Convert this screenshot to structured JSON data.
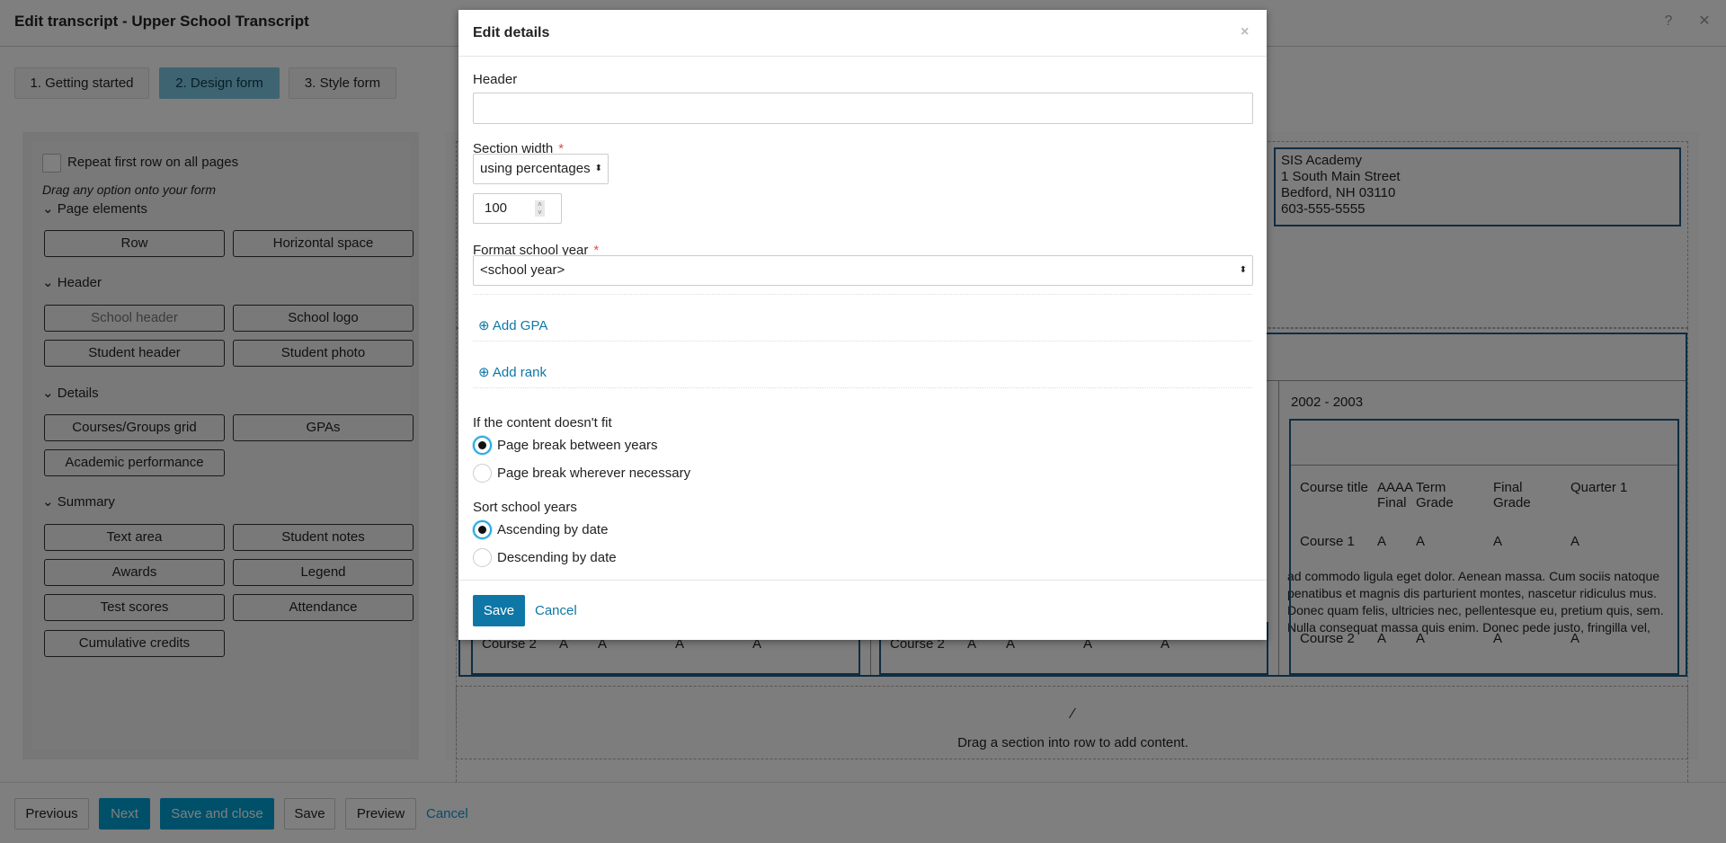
{
  "window": {
    "title": "Edit transcript - Upper School Transcript",
    "help_icon": "question-circle-icon",
    "close_icon": "close-icon"
  },
  "tabs": [
    {
      "label": "1. Getting started",
      "active": false
    },
    {
      "label": "2. Design form",
      "active": true
    },
    {
      "label": "3. Style form",
      "active": false
    }
  ],
  "palette": {
    "repeat_first_row": "Repeat first row on all pages",
    "hint": "Drag any option onto your form",
    "sections": [
      {
        "title": "Page elements",
        "items": [
          "Row",
          "Horizontal space"
        ]
      },
      {
        "title": "Header",
        "items": [
          "School header",
          "School logo",
          "Student header",
          "Student photo"
        ]
      },
      {
        "title": "Details",
        "items": [
          "Courses/Groups grid",
          "GPAs",
          "Academic performance"
        ]
      },
      {
        "title": "Summary",
        "items": [
          "Text area",
          "Student notes",
          "Awards",
          "Legend",
          "Test scores",
          "Attendance",
          "Cumulative credits"
        ]
      }
    ]
  },
  "canvas": {
    "school_address": [
      "SIS Academy",
      "1 South  Main Street",
      "Bedford, NH 03110",
      " 603-555-5555"
    ],
    "year": "2002 - 2003",
    "grid_headers": [
      "Course title",
      "AAAA Final",
      "Term Grade",
      "Final Grade",
      "Quarter 1"
    ],
    "rows": [
      [
        "Course 1",
        "A",
        "A",
        "A",
        "A"
      ],
      [
        "Course 2",
        "A",
        "A",
        "A",
        "A"
      ]
    ],
    "lorem": "ad commodo ligula eget dolor. Aenean massa. Cum sociis natoque penatibus et magnis dis parturient montes, nascetur ridiculus mus. Donec quam felis, ultricies nec, pellentesque eu, pretium quis, sem. Nulla consequat massa quis enim. Donec pede justo, fringilla vel, aliquet nec, vulputate eget, arcu. In enim justo, rhoncus ut, imperdiet a, venenatis vitae, justo. Nullam dictum felis eu pede mollis pretium.",
    "drop_hint": "Drag a section into row to add content.",
    "drop_icon": "magic-wand-icon"
  },
  "footer": {
    "previous": "Previous",
    "next": "Next",
    "save_close": "Save and close",
    "save": "Save",
    "preview": "Preview",
    "cancel": "Cancel"
  },
  "modal": {
    "title": "Edit details",
    "header_label": "Header",
    "header_value": "",
    "section_width_label": "Section width",
    "section_width_unit": "using percentages",
    "section_width_value": "100",
    "format_label": "Format school year",
    "format_value": "<school year>",
    "add_gpa": "Add GPA",
    "add_rank": "Add rank",
    "fit_label": "If the content doesn't fit",
    "fit_options": [
      {
        "label": "Page break between years",
        "selected": true
      },
      {
        "label": "Page break wherever necessary",
        "selected": false
      }
    ],
    "sort_label": "Sort school years",
    "sort_options": [
      {
        "label": "Ascending by date",
        "selected": true
      },
      {
        "label": "Descending by date",
        "selected": false
      }
    ],
    "save": "Save",
    "cancel": "Cancel"
  },
  "colors": {
    "accent": "#0e77a6",
    "active_tab": "#7ec8e3",
    "grid_border": "#1f5a85"
  }
}
